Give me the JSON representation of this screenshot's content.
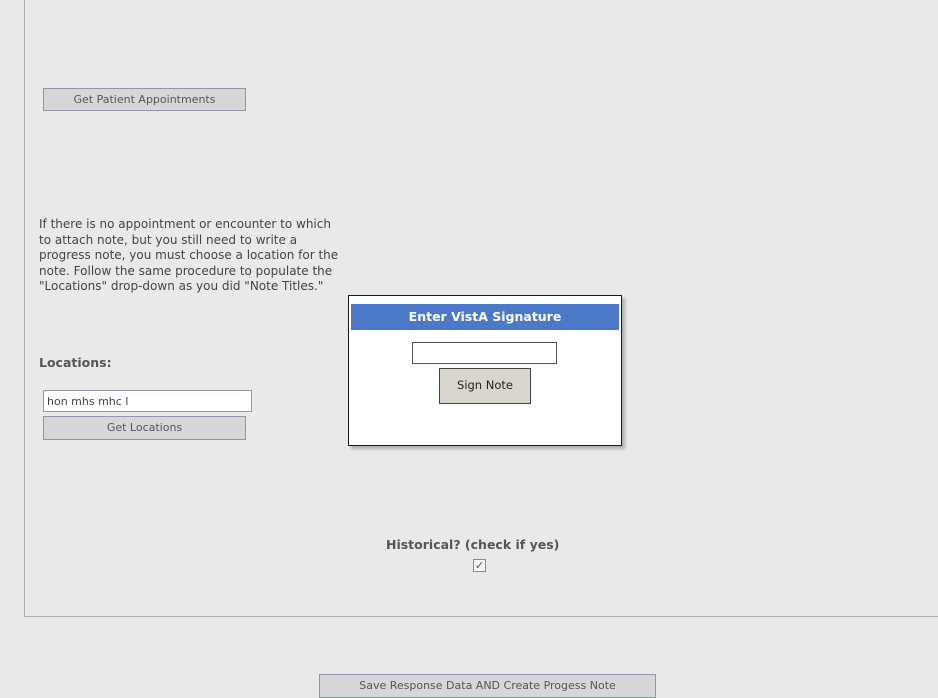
{
  "appointments": {
    "button_label": "Get Patient Appointments"
  },
  "help": {
    "text": "If there is no appointment or encounter to which to attach note, but you still need to write a progress note, you must choose a location for the note. Follow the same procedure to populate the \"Locations\" drop-down as you did \"Note Titles.\""
  },
  "locations": {
    "label": "Locations:",
    "input_value": "hon mhs mhc l",
    "button_label": "Get Locations"
  },
  "signature_dialog": {
    "title": "Enter VistA Signature",
    "input_value": "",
    "sign_button_label": "Sign Note"
  },
  "historical": {
    "label": "Historical? (check if yes)",
    "checked": true,
    "check_glyph": "✓"
  },
  "footer": {
    "save_button_label": "Save Response Data AND Create Progess Note"
  }
}
